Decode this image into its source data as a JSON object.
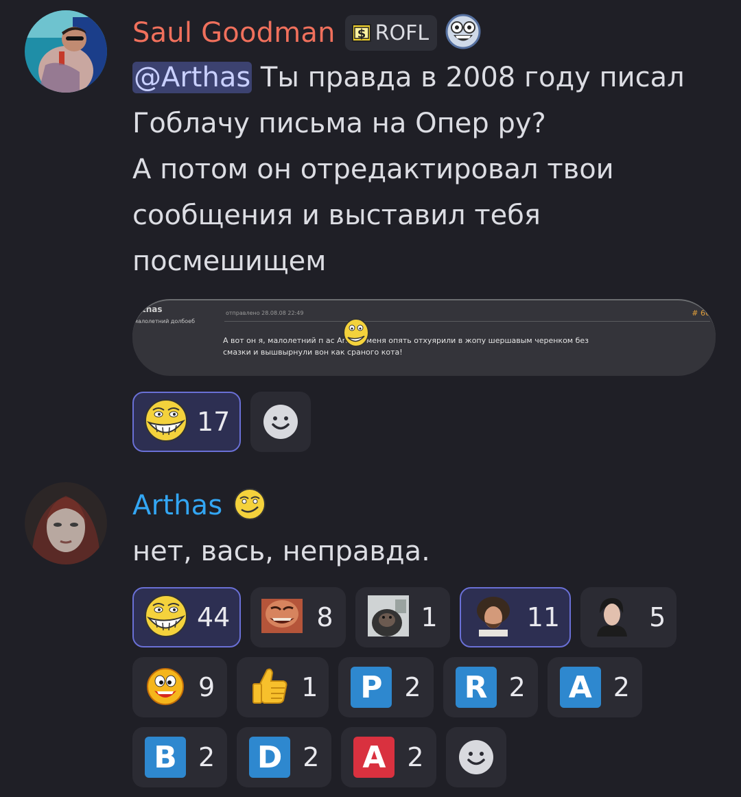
{
  "messages": [
    {
      "username": "Saul Goodman",
      "role_tag": "ROFL",
      "mention": "@Arthas",
      "lines": [
        "Ты правда в 2008 году писал",
        "Гоблачу письма на Опер ру?",
        "А потом он отредактировал твои",
        "сообщения и выставил тебя",
        "посмешищем"
      ],
      "embed": {
        "author": "thas",
        "subtitle": "малолетний долбоеб",
        "date": "отправлено 28.08.08 22:49",
        "post_number": "# 66",
        "body_line1": "А вот он я, малолетний п       ас Arthas, меня опять отхуярили в жопу шершавым черенком без",
        "body_line2": "смазки и вышвырнули вон как сраного кота!"
      },
      "reactions": [
        {
          "emoji": "trollface-icon",
          "count": "17",
          "active": true
        }
      ]
    },
    {
      "username": "Arthas",
      "text": "нет, вась, неправда.",
      "reactions": [
        {
          "emoji": "trollface-icon",
          "count": "44",
          "active": true
        },
        {
          "emoji": "laughing-man-icon",
          "count": "8",
          "active": false
        },
        {
          "emoji": "monkey-icon",
          "count": "1",
          "active": false
        },
        {
          "emoji": "bob-ross-icon",
          "count": "11",
          "active": true
        },
        {
          "emoji": "man-portrait-icon",
          "count": "5",
          "active": false
        },
        {
          "emoji": "yellow-smiley-icon",
          "count": "9",
          "active": false
        },
        {
          "emoji": "thumbs-up-icon",
          "count": "1",
          "active": false
        },
        {
          "emoji": "letter-p-icon",
          "letter": "P",
          "count": "2",
          "active": false
        },
        {
          "emoji": "letter-r-icon",
          "letter": "R",
          "count": "2",
          "active": false
        },
        {
          "emoji": "letter-a-icon",
          "letter": "A",
          "count": "2",
          "active": false
        },
        {
          "emoji": "letter-b-icon",
          "letter": "B",
          "count": "2",
          "active": false
        },
        {
          "emoji": "letter-d-icon",
          "letter": "D",
          "count": "2",
          "active": false
        },
        {
          "emoji": "letter-a-red-icon",
          "letter": "A",
          "count": "2",
          "active": false
        }
      ]
    }
  ],
  "colors": {
    "background": "#1f1f26",
    "saul_name": "#f0705c",
    "arthas_name": "#33a6f3",
    "mention_bg": "#3c4270",
    "reaction_bg": "#2b2b33",
    "reaction_active_border": "#6a70d6",
    "letter_blue": "#2e88cf",
    "letter_red": "#d9313f"
  }
}
